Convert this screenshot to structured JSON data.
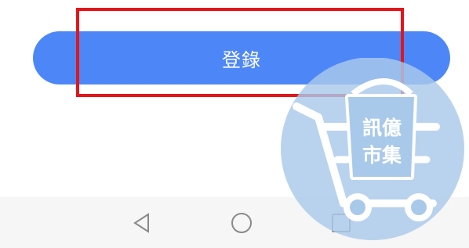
{
  "login": {
    "label": "登錄"
  },
  "navigation_bar": {
    "back_icon": "triangle-back-icon",
    "home_icon": "circle-home-icon",
    "recents_icon": "square-recents-icon"
  },
  "watermark": {
    "line1": "訊億",
    "line2": "市集"
  },
  "colors": {
    "button": "#4d87f7",
    "highlight": "#e3151a",
    "navbar": "#f6f6f6",
    "watermark": "#a9c9ea"
  }
}
